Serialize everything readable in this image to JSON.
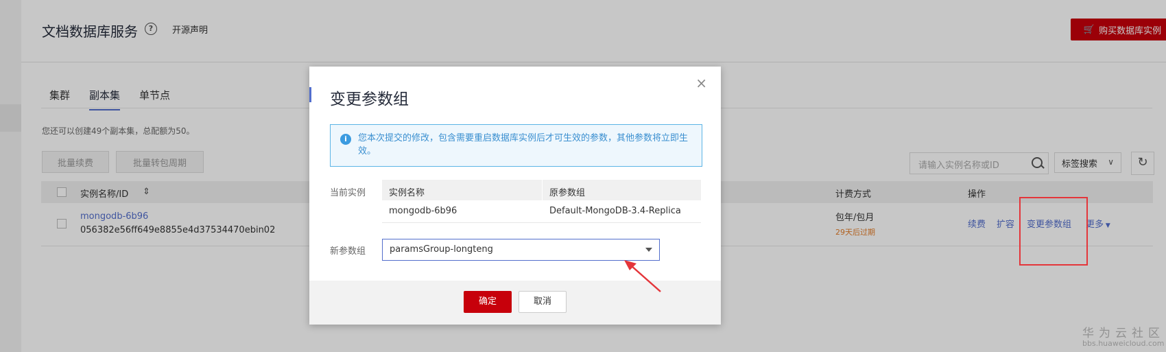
{
  "header": {
    "title": "文档数据库服务",
    "open_source": "开源声明",
    "buy_button": "购买数据库实例"
  },
  "tabs": [
    {
      "label": "集群"
    },
    {
      "label": "副本集",
      "active": true
    },
    {
      "label": "单节点"
    }
  ],
  "quota_text": "您还可以创建49个副本集，总配额为50。",
  "toolbar": {
    "batch_renew": "批量续费",
    "batch_convert": "批量转包周期",
    "search_placeholder": "请输入实例名称或ID",
    "tag_search": "标签搜索"
  },
  "table": {
    "headers": {
      "name_id": "实例名称/ID",
      "billing": "计费方式",
      "actions": "操作"
    },
    "row": {
      "name": "mongodb-6b96",
      "id": "056382e56ff649e8855e4d37534470ebin02",
      "billing": "包年/包月",
      "expire": "29天后过期",
      "actions": {
        "renew": "续费",
        "scale": "扩容",
        "change_params": "变更参数组",
        "more": "更多"
      }
    }
  },
  "modal": {
    "title": "变更参数组",
    "info": "您本次提交的修改，包含需要重启数据库实例后才可生效的参数，其他参数将立即生效。",
    "current_label": "当前实例",
    "col_name": "实例名称",
    "col_group": "原参数组",
    "instance_name": "mongodb-6b96",
    "instance_group": "Default-MongoDB-3.4-Replica",
    "new_label": "新参数组",
    "new_group": "paramsGroup-longteng",
    "ok": "确定",
    "cancel": "取消"
  },
  "watermark": {
    "brand": "华为云社区",
    "url": "bbs.huaweicloud.com"
  },
  "colors": {
    "brand_red": "#c7000b",
    "link_blue": "#526ecc",
    "annotation_red": "#e4353a",
    "info_blue": "#3b9be0"
  }
}
